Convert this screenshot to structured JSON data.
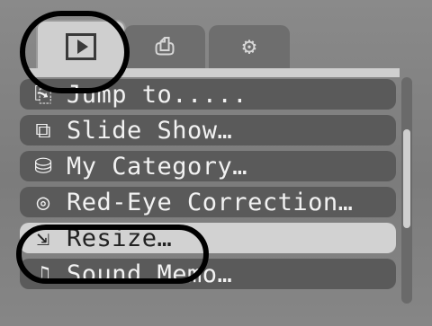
{
  "tabs": [
    {
      "name": "playback",
      "icon": "play-icon",
      "active": true
    },
    {
      "name": "print",
      "icon": "print-icon",
      "active": false
    },
    {
      "name": "setup",
      "icon": "setup-icon",
      "active": false
    }
  ],
  "menu": {
    "items": [
      {
        "label": "Jump to.....",
        "icon": "jump-icon",
        "glyph": "⎘"
      },
      {
        "label": "Slide Show…",
        "icon": "slideshow-icon",
        "glyph": "⧉"
      },
      {
        "label": "My Category…",
        "icon": "category-icon",
        "glyph": "⛁"
      },
      {
        "label": "Red-Eye Correction…",
        "icon": "red-eye-icon",
        "glyph": "◎"
      },
      {
        "label": "Resize…",
        "icon": "resize-icon",
        "glyph": "⇲"
      },
      {
        "label": "Sound Memo…",
        "icon": "microphone-icon",
        "glyph": "♫"
      }
    ],
    "selected_index": 4
  },
  "colors": {
    "background": "#808080",
    "item": "#5a5a5a",
    "item_selected": "#d2d2d2",
    "highlight_ring": "#000000"
  },
  "scroll": {
    "position": 0.4
  }
}
